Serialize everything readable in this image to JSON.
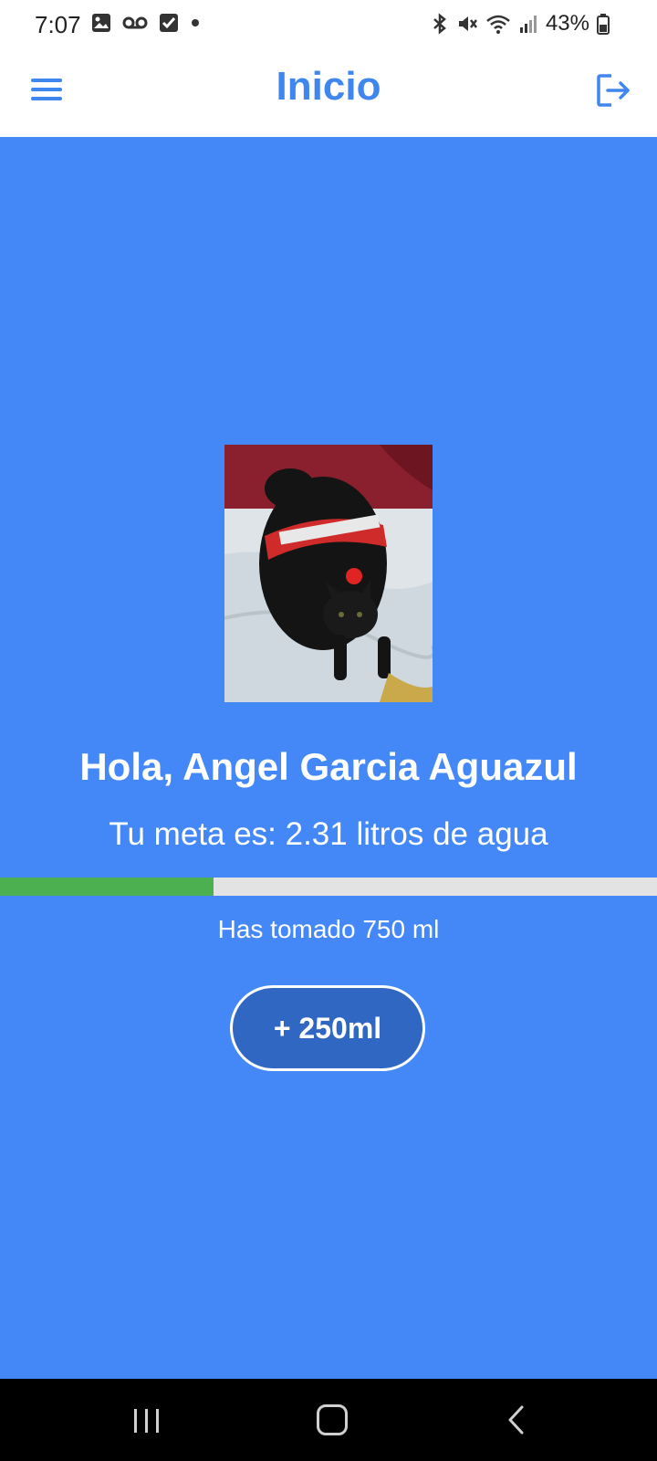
{
  "status_bar": {
    "time": "7:07",
    "battery": "43%",
    "left_icons": [
      "gallery-icon",
      "voicemail-icon",
      "checkbox-icon",
      "dot-icon"
    ],
    "right_icons": [
      "bluetooth-icon",
      "mute-icon",
      "wifi-icon",
      "signal-icon",
      "battery-icon"
    ]
  },
  "app_bar": {
    "title": "Inicio",
    "menu_icon": "menu-icon",
    "logout_icon": "logout-icon"
  },
  "profile": {
    "greeting": "Hola, Angel Garcia Aguazul",
    "goal": "Tu meta es: 2.31 litros de agua",
    "consumed": "Has tomado 750 ml",
    "progress_fraction": 0.325
  },
  "actions": {
    "add_label": "+ 250ml"
  },
  "nav_bar": {
    "icons": [
      "recents-icon",
      "home-icon",
      "back-icon"
    ]
  },
  "colors": {
    "primary": "#3f86ef",
    "background": "#4488f8",
    "progress": "#4caf50",
    "track": "#e3e3e3",
    "button": "#2f67c2"
  }
}
